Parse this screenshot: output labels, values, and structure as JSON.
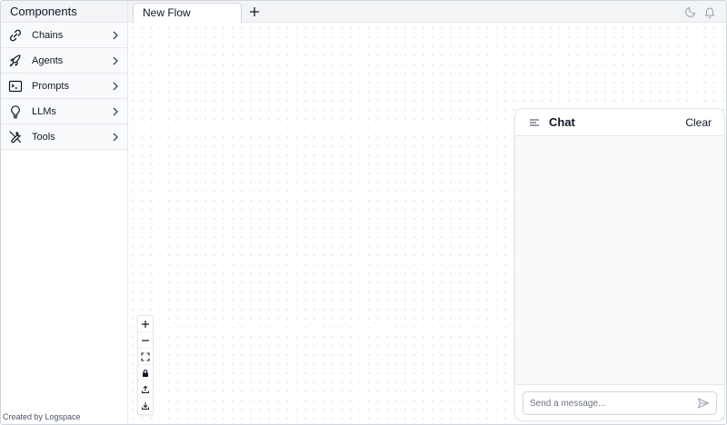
{
  "sidebar": {
    "title": "Components",
    "items": [
      {
        "label": "Chains",
        "icon": "link-icon"
      },
      {
        "label": "Agents",
        "icon": "rocket-icon"
      },
      {
        "label": "Prompts",
        "icon": "terminal-icon"
      },
      {
        "label": "LLMs",
        "icon": "lightbulb-icon"
      },
      {
        "label": "Tools",
        "icon": "wrench-screwdriver-icon"
      }
    ],
    "footer": "Created by Logspace"
  },
  "tabs": [
    {
      "label": "New Flow"
    }
  ],
  "chat": {
    "title": "Chat",
    "clear_label": "Clear",
    "input_placeholder": "Send a message...",
    "input_value": ""
  },
  "colors": {
    "border": "#e5e7eb",
    "panel_bg": "#f3f4f6",
    "canvas_dot": "#e5e7eb",
    "text": "#111827",
    "muted": "#6b7280"
  }
}
